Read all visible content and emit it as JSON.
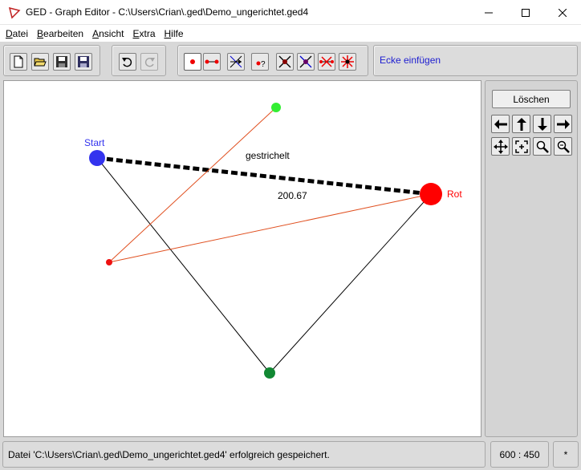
{
  "window": {
    "title": "GED - Graph Editor - C:\\Users\\Crian\\.ged\\Demo_ungerichtet.ged4"
  },
  "menu": [
    {
      "label": "Datei"
    },
    {
      "label": "Bearbeiten"
    },
    {
      "label": "Ansicht"
    },
    {
      "label": "Extra"
    },
    {
      "label": "Hilfe"
    }
  ],
  "toolbar": {
    "mode_hint": "Ecke einfügen",
    "icons": {
      "file": [
        "new-file-icon",
        "open-folder-icon",
        "save-icon",
        "save-as-icon"
      ],
      "history": [
        "undo-icon",
        "redo-icon"
      ],
      "modes": [
        "insert-vertex-icon",
        "insert-edge-icon",
        "move-icon",
        "vertex-properties-icon",
        "delete-vertex-icon",
        "delete-vertex-alt-icon",
        "delete-edge-icon",
        "delete-all-icon"
      ]
    }
  },
  "side_panel": {
    "delete_label": "Löschen",
    "icons": [
      "arrow-left-icon",
      "arrow-up-icon",
      "arrow-down-icon",
      "arrow-right-icon",
      "move-all-icon",
      "fit-view-icon",
      "zoom-in-icon",
      "zoom-out-icon"
    ]
  },
  "graph": {
    "vertices": [
      {
        "id": "start",
        "label": "Start",
        "color": "#3333ee"
      },
      {
        "id": "rot",
        "label": "Rot",
        "color": "#ff0000"
      },
      {
        "id": "green_top",
        "label": "",
        "color": "#33ee33"
      },
      {
        "id": "red_small",
        "label": "",
        "color": "#ee1111"
      },
      {
        "id": "green_bottom",
        "label": "",
        "color": "#118833"
      }
    ],
    "edges": [
      {
        "from": "start",
        "to": "rot",
        "style": "dashed",
        "label": "gestrichelt",
        "weight": "200.67",
        "color": "#000000"
      },
      {
        "from": "start",
        "to": "green_bottom",
        "style": "solid",
        "color": "#000000"
      },
      {
        "from": "green_bottom",
        "to": "rot",
        "style": "solid",
        "color": "#000000"
      },
      {
        "from": "red_small",
        "to": "green_top",
        "style": "solid",
        "color": "#e05020"
      },
      {
        "from": "red_small",
        "to": "rot",
        "style": "solid",
        "color": "#e05020"
      }
    ]
  },
  "statusbar": {
    "message": "Datei 'C:\\Users\\Crian\\.ged\\Demo_ungerichtet.ged4' erfolgreich gespeichert.",
    "canvas_size": "600 : 450",
    "modified_flag": "*"
  }
}
